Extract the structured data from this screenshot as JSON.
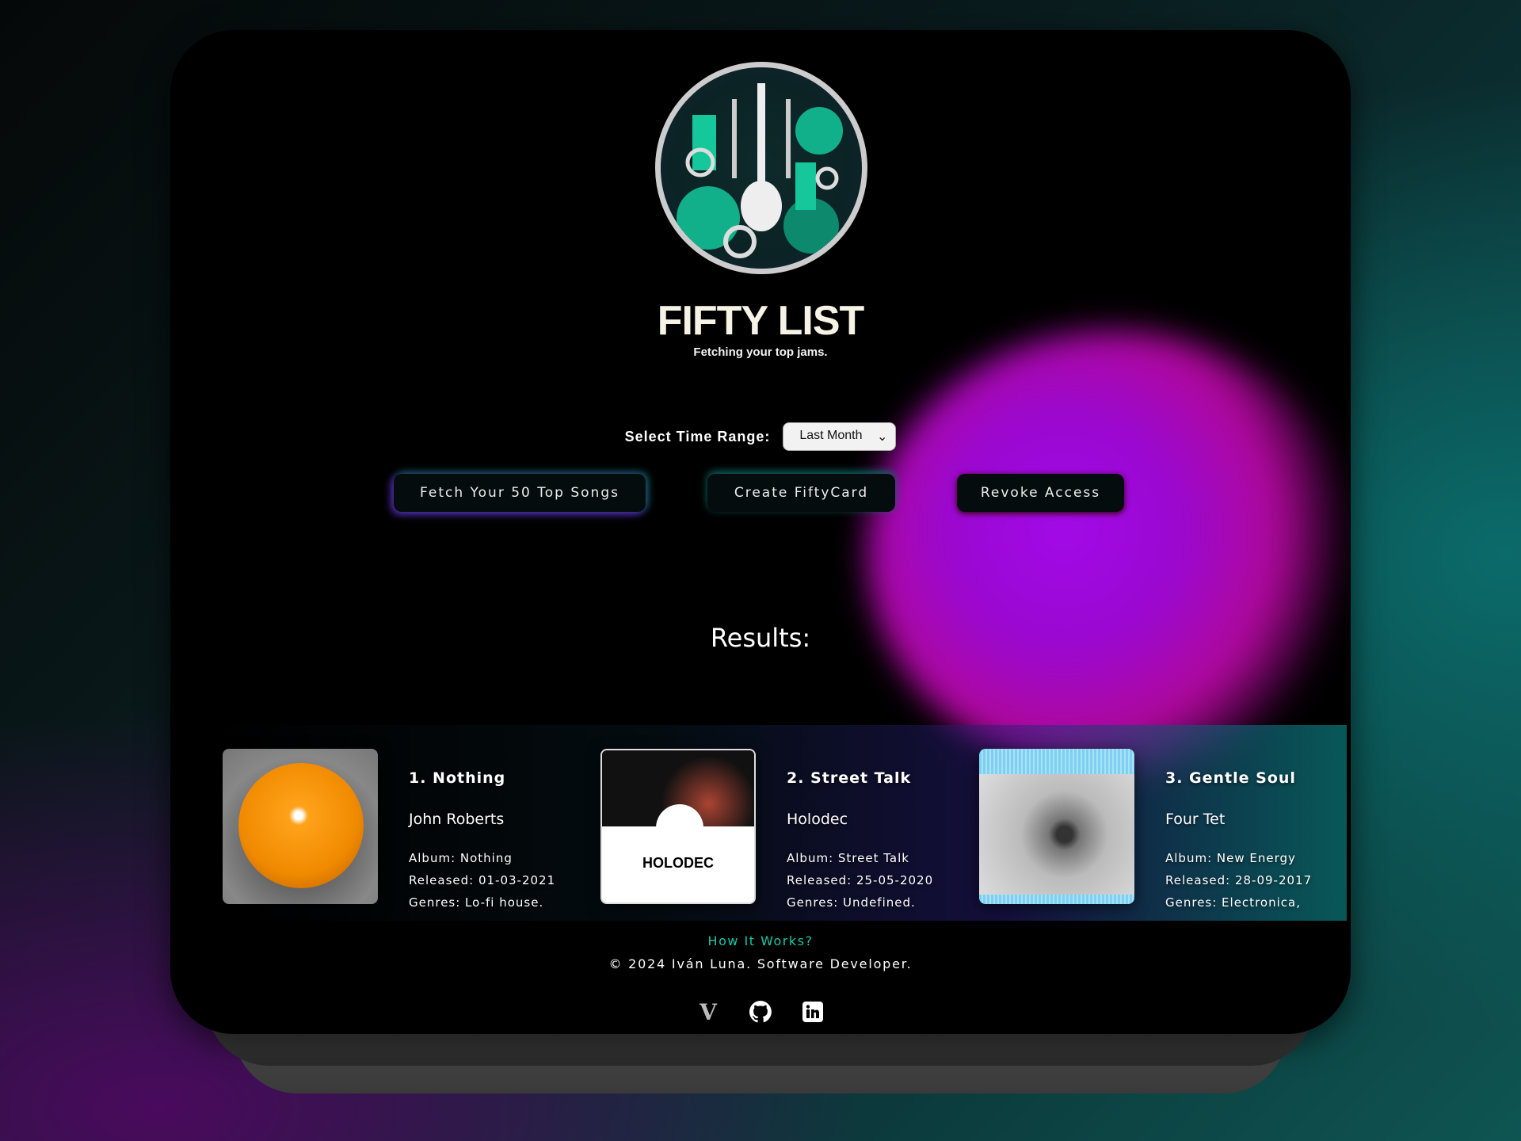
{
  "app": {
    "title": "FIFTY LIST",
    "tagline": "Fetching your top jams."
  },
  "controls": {
    "time_range_label": "Select Time Range:",
    "time_range_value": "Last Month",
    "fetch_label": "Fetch Your 50 Top Songs",
    "create_card_label": "Create FiftyCard",
    "revoke_label": "Revoke Access"
  },
  "results": {
    "heading": "Results:",
    "items": [
      {
        "title": "1. Nothing",
        "artist": "John Roberts",
        "album": "Album: Nothing",
        "released": "Released: 01-03-2021",
        "genres": "Genres: Lo-fi house."
      },
      {
        "title": "2. Street Talk",
        "artist": "Holodec",
        "album": "Album: Street Talk",
        "released": "Released: 25-05-2020",
        "genres": "Genres: Undefined.",
        "cover_text": "HOLODEC"
      },
      {
        "title": "3. Gentle Soul",
        "artist": "Four Tet",
        "album": "Album: New Energy",
        "released": "Released: 28-09-2017",
        "genres": "Genres: Electronica,"
      }
    ]
  },
  "footer": {
    "how_link": "How It Works?",
    "copyright": "© 2024 Iván Luna. Software Developer.",
    "icons": [
      "portfolio-v-icon",
      "github-icon",
      "linkedin-icon"
    ]
  },
  "colors": {
    "accent": "#19c9a8",
    "glow_purple": "#a20ae8",
    "glow_teal": "#0e6a66"
  }
}
